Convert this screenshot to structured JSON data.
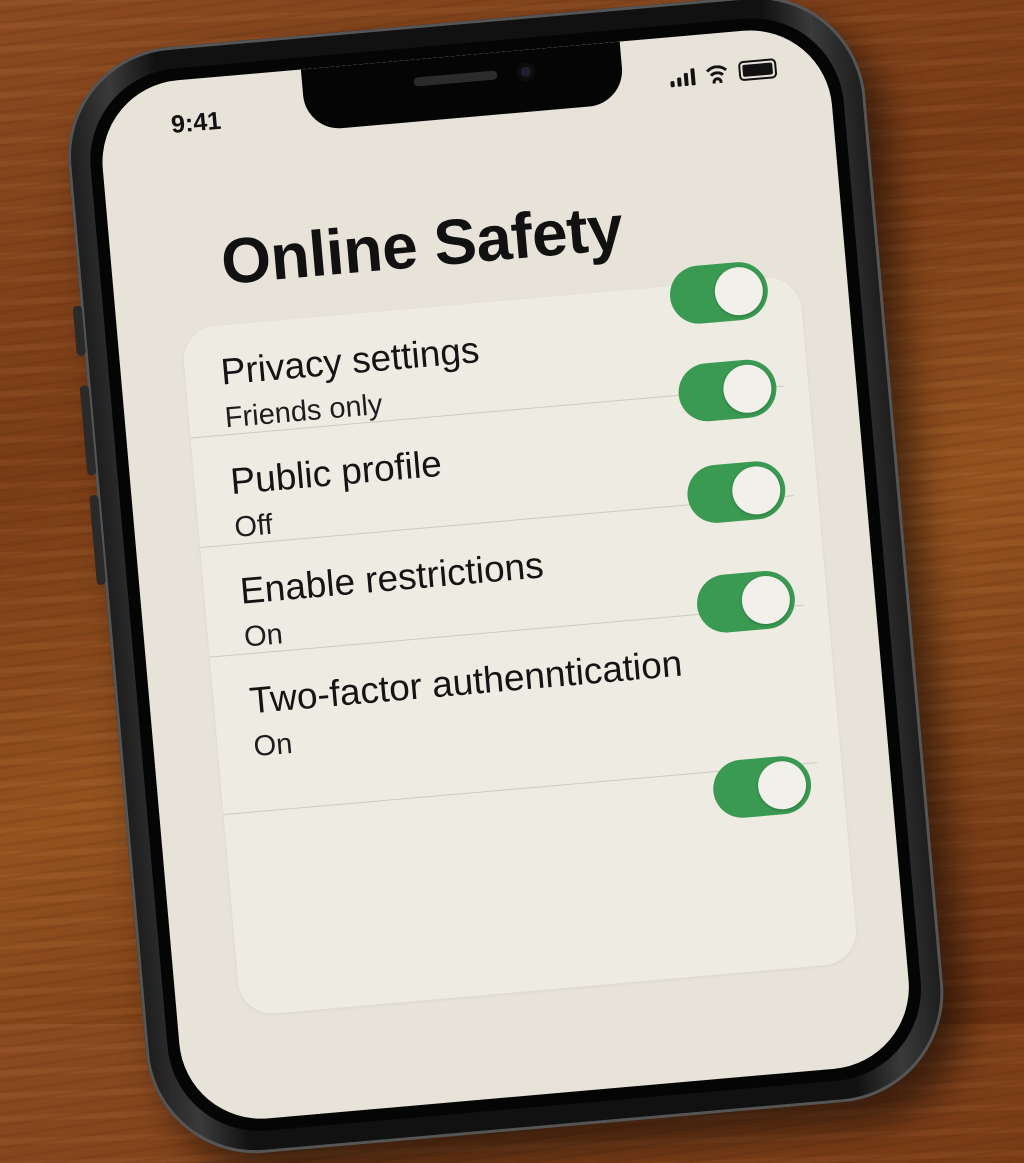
{
  "status_bar": {
    "time": "9:41"
  },
  "page": {
    "title": "Online Safety"
  },
  "settings": [
    {
      "label": "Privacy settings",
      "value": "Friends only",
      "enabled": true
    },
    {
      "label": "Public profile",
      "value": "Off",
      "enabled": true
    },
    {
      "label": "Enable restrictions",
      "value": "On",
      "enabled": true
    },
    {
      "label": "Two-factor authenntication",
      "value": "On",
      "enabled": true
    }
  ],
  "colors": {
    "toggle_on": "#3a9a52",
    "screen_background": "#e7e3d9",
    "card_background": "#eeebe2"
  },
  "icons": [
    "signal-icon",
    "wifi-icon",
    "battery-icon"
  ]
}
